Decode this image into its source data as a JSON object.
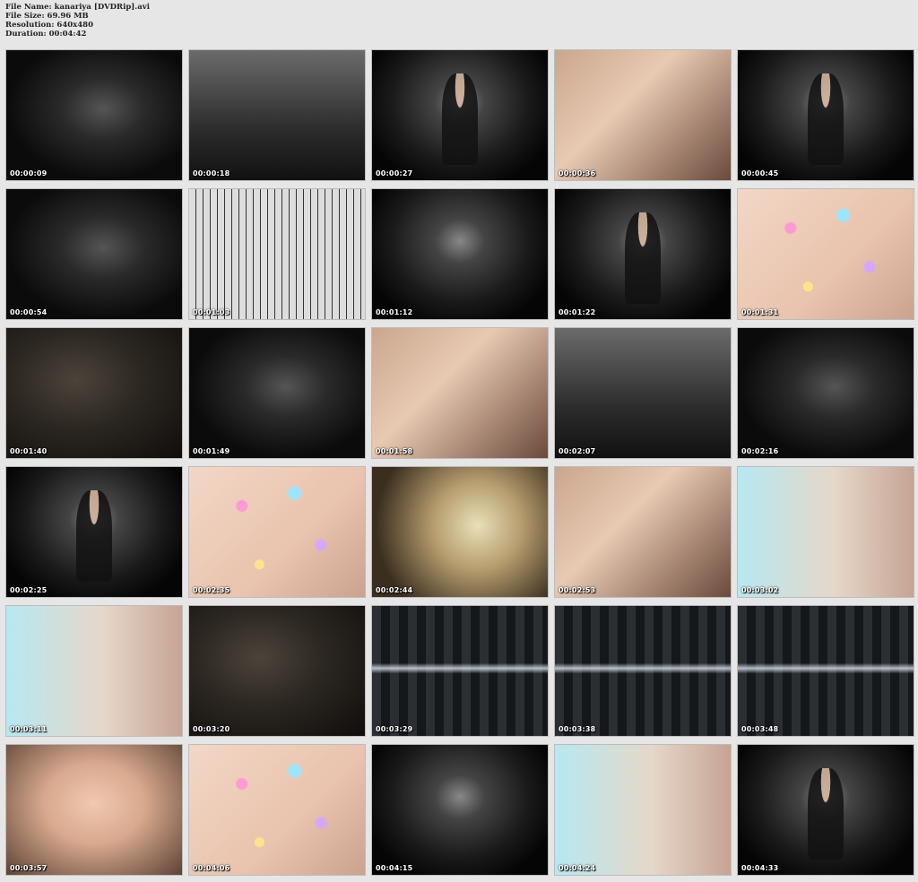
{
  "header": {
    "file_name": "File Name: kanariya [DVDRip].avi",
    "file_size": "File Size: 69.96 MB",
    "resolution": "Resolution: 640x480",
    "duration": "Duration: 00:04:42"
  },
  "thumbnails": [
    {
      "time": "00:00:09",
      "scene": "dark-studio"
    },
    {
      "time": "00:00:18",
      "scene": "studio-grey"
    },
    {
      "time": "00:00:27",
      "scene": "throne figure"
    },
    {
      "time": "00:00:36",
      "scene": "warm"
    },
    {
      "time": "00:00:45",
      "scene": "throne figure"
    },
    {
      "time": "00:00:54",
      "scene": "dark-studio"
    },
    {
      "time": "00:01:03",
      "scene": "keys"
    },
    {
      "time": "00:01:12",
      "scene": "throne"
    },
    {
      "time": "00:01:22",
      "scene": "throne figure"
    },
    {
      "time": "00:01:31",
      "scene": "jewel"
    },
    {
      "time": "00:01:40",
      "scene": "raven"
    },
    {
      "time": "00:01:49",
      "scene": "dark-studio"
    },
    {
      "time": "00:01:58",
      "scene": "warm"
    },
    {
      "time": "00:02:07",
      "scene": "studio-grey"
    },
    {
      "time": "00:02:16",
      "scene": "dark-studio"
    },
    {
      "time": "00:02:25",
      "scene": "throne figure"
    },
    {
      "time": "00:02:35",
      "scene": "jewel"
    },
    {
      "time": "00:02:44",
      "scene": "glow"
    },
    {
      "time": "00:02:53",
      "scene": "warm"
    },
    {
      "time": "00:03:02",
      "scene": "pale-blue"
    },
    {
      "time": "00:03:11",
      "scene": "pale-blue"
    },
    {
      "time": "00:03:20",
      "scene": "raven"
    },
    {
      "time": "00:03:29",
      "scene": "streak"
    },
    {
      "time": "00:03:38",
      "scene": "streak"
    },
    {
      "time": "00:03:48",
      "scene": "streak"
    },
    {
      "time": "00:03:57",
      "scene": "face"
    },
    {
      "time": "00:04:06",
      "scene": "jewel"
    },
    {
      "time": "00:04:15",
      "scene": "throne"
    },
    {
      "time": "00:04:24",
      "scene": "pale-blue"
    },
    {
      "time": "00:04:33",
      "scene": "throne figure"
    }
  ]
}
